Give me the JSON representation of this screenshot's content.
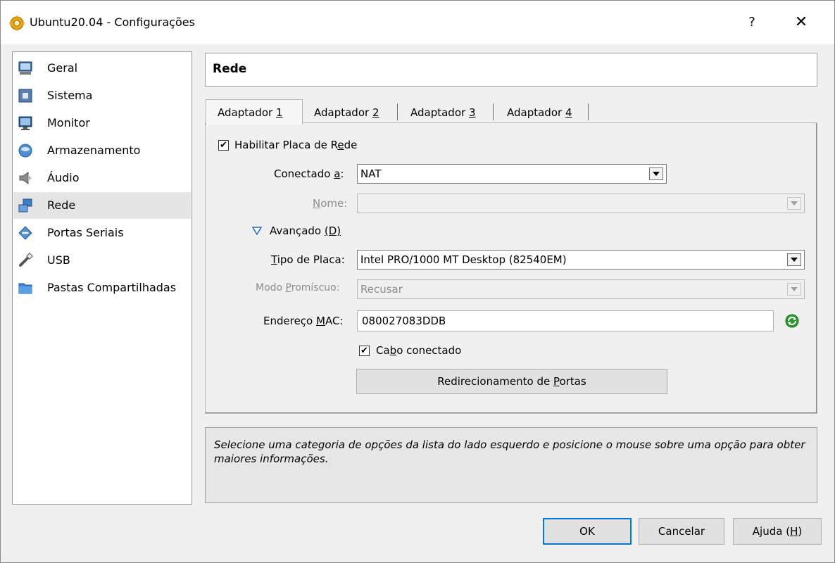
{
  "window": {
    "title": "Ubuntu20.04 - Configurações",
    "help_label": "?",
    "close_label": "✕"
  },
  "sidebar": {
    "items": [
      {
        "label": "Geral",
        "icon": "monitor-general-icon"
      },
      {
        "label": "Sistema",
        "icon": "chip-icon"
      },
      {
        "label": "Monitor",
        "icon": "display-icon"
      },
      {
        "label": "Armazenamento",
        "icon": "disk-icon"
      },
      {
        "label": "Áudio",
        "icon": "speaker-icon"
      },
      {
        "label": "Rede",
        "icon": "network-icon",
        "selected": true
      },
      {
        "label": "Portas Seriais",
        "icon": "serial-port-icon"
      },
      {
        "label": "USB",
        "icon": "usb-icon"
      },
      {
        "label": "Pastas Compartilhadas",
        "icon": "folder-icon"
      }
    ]
  },
  "header": {
    "title": "Rede"
  },
  "tabs": [
    {
      "prefix": "Adaptador ",
      "key": "1",
      "active": true
    },
    {
      "prefix": "Adaptador ",
      "key": "2"
    },
    {
      "prefix": "Adaptador ",
      "key": "3"
    },
    {
      "prefix": "Adaptador ",
      "key": "4"
    }
  ],
  "form": {
    "enable": {
      "pre": "Habilitar Placa de R",
      "key": "e",
      "post": "de",
      "checked": true
    },
    "attached": {
      "pre": "Conectado ",
      "key": "a",
      "post": ":",
      "value": "NAT"
    },
    "name": {
      "pre": "",
      "key": "N",
      "post": "ome:",
      "value": ""
    },
    "advanced": {
      "pre": "Avançado ",
      "key": "(D)",
      "expanded": true
    },
    "adapter_type": {
      "pre": "",
      "key": "T",
      "post": "ipo de Placa:",
      "value": "Intel PRO/1000 MT Desktop (82540EM)"
    },
    "promiscuous": {
      "pre": "Modo ",
      "key": "P",
      "post": "romíscuo:",
      "value": "Recusar"
    },
    "mac": {
      "pre": "Endereço ",
      "key": "M",
      "post": "AC:",
      "value": "080027083DDB"
    },
    "cable": {
      "pre": "Ca",
      "key": "b",
      "post": "o conectado",
      "checked": true
    },
    "port_forwarding": {
      "pre": "Redirecionamento de ",
      "key": "P",
      "post": "ortas"
    }
  },
  "info": {
    "text": "Selecione uma categoria de opções da lista do lado esquerdo e posicione o mouse sobre uma opção para obter maiores informações."
  },
  "footer": {
    "ok": "OK",
    "cancel": "Cancelar",
    "help": {
      "pre": "Ajuda (",
      "key": "H",
      "post": ")"
    }
  },
  "colors": {
    "refresh_green": "#2e9a2e",
    "selection": "#e5e5e5",
    "focus_blue": "#0078d7"
  }
}
